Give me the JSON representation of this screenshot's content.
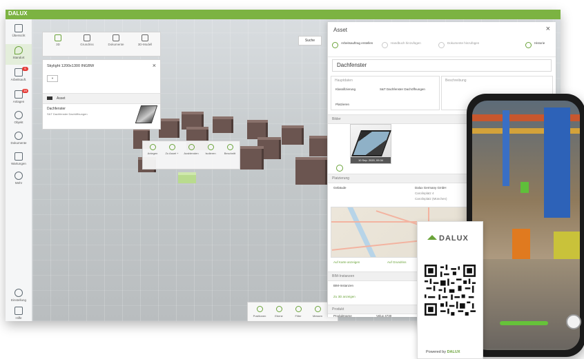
{
  "app": {
    "brand": "DALUX"
  },
  "sidebar": {
    "items": [
      {
        "label": "Übersicht",
        "icon": "grid-icon"
      },
      {
        "label": "Standort",
        "icon": "location-icon",
        "active": true
      },
      {
        "label": "Arbeitsauft.",
        "icon": "task-icon",
        "badge": "6"
      },
      {
        "label": "Anlagen",
        "icon": "asset-icon",
        "badge": "16"
      },
      {
        "label": "Objekt",
        "icon": "cube-icon"
      },
      {
        "label": "Dokumente",
        "icon": "documents-icon"
      },
      {
        "label": "Wartungen",
        "icon": "maintenance-icon"
      },
      {
        "label": "Mehr",
        "icon": "more-icon"
      },
      {
        "label": "Einstellung",
        "icon": "settings-icon"
      },
      {
        "label": "Hilfe",
        "icon": "help-icon"
      }
    ]
  },
  "viewer": {
    "tools": [
      {
        "label": "3D",
        "icon": "cube-icon",
        "active": true
      },
      {
        "label": "Grundriss",
        "icon": "floorplan-icon"
      },
      {
        "label": "Dokumente",
        "icon": "document-icon"
      },
      {
        "label": "3D-Modell",
        "icon": "model-icon"
      }
    ],
    "panel": {
      "title": "Skylight 1200x1300 INGBW",
      "section": "Asset",
      "item_title": "Dachfenster",
      "item_subtitle": "S&T Dachfenster Dachöffnungen"
    },
    "chip_label": "Suche",
    "context_menu": [
      {
        "label": "Anlegen",
        "icon": "add-icon"
      },
      {
        "label": "Zu Asset +",
        "icon": "link-icon"
      },
      {
        "label": "Ausblenden",
        "icon": "hide-icon"
      },
      {
        "label": "Isolieren",
        "icon": "isolate-icon"
      },
      {
        "label": "Beschnitt",
        "icon": "scissors-icon"
      }
    ],
    "bottom_toolbar": [
      {
        "label": "Positionen",
        "icon": "position-icon"
      },
      {
        "label": "Ebene",
        "icon": "layer-icon"
      },
      {
        "label": "Filter",
        "icon": "filter-icon"
      },
      {
        "label": "Messen",
        "icon": "measure-icon"
      }
    ]
  },
  "asset_panel": {
    "title": "Asset",
    "steps": [
      {
        "label": "Arbeitsauftrag erstellen",
        "done": true
      },
      {
        "label": "Handbuch hinzufügen",
        "done": false
      },
      {
        "label": "Dokumente hinzufügen",
        "done": false
      },
      {
        "label": "Historie",
        "done": true
      }
    ],
    "name": "Dachfenster",
    "cards": {
      "left_header": "Hauptdaten",
      "right_header": "Beschreibung",
      "classification_label": "Klassifizierung",
      "classification_value": "S&T Dachfenster Dachöffnungen",
      "placement_label": "Platzieren"
    },
    "images_section": "Bilder",
    "image_caption": "10 Sep. 2020, 09:34",
    "location_section": "Platzierung",
    "building_label": "Gebäude",
    "company_name": "Dalux Germany GmbH",
    "company_line2": "Carolinplatz 4",
    "company_line3": "Carolinplatz (München)",
    "map_link_left": "Auf Karte anzeigen",
    "map_link_right": "Auf Grundriss",
    "bim_section": "BIM-Instanzen",
    "bim_label": "BIM-Instanzen",
    "bim_link": "Zu 3D anzeigen",
    "product_section": "Produkt",
    "product_label": "Produktname",
    "product_value": "Velux 4730"
  },
  "qr_card": {
    "brand": "DALUX",
    "powered_by": "Powered by",
    "powered_brand": "DALUX"
  },
  "colors": {
    "brand_green": "#7cb342",
    "accent_green": "#6aa339"
  }
}
